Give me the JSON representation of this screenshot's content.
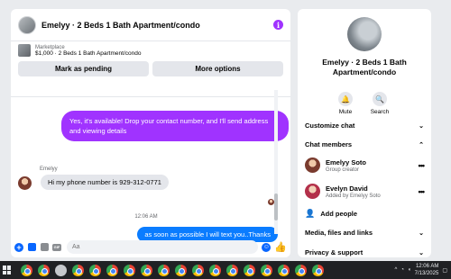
{
  "chat": {
    "title": "Emelyy · 2 Beds 1 Bath Apartment/condo",
    "info_icon": "info-icon",
    "marketplace": {
      "label": "Marketplace",
      "price_line": "$1,000 · 2 Beds 1 Bath Apartment/condo",
      "buttons": [
        "Mark as pending",
        "More options"
      ]
    },
    "messages": {
      "outgoing_1": "Yes, it's available! Drop your contact number, and I'll send address and viewing details",
      "incoming_name": "Emelyy",
      "incoming_1": "Hi my phone number is 929-312-0771",
      "timestamp": "12:06 AM",
      "outgoing_2": "as soon as possible I will text you..Thanks"
    },
    "composer": {
      "placeholder": "Aa"
    }
  },
  "info": {
    "title": "Emelyy · 2 Beds 1 Bath Apartment/condo",
    "actions": {
      "mute": "Mute",
      "search": "Search"
    },
    "sections": {
      "customize": "Customize chat",
      "members": "Chat members",
      "media": "Media, files and links",
      "privacy": "Privacy & support"
    },
    "members": [
      {
        "name": "Emelyy Soto",
        "sub": "Group creator"
      },
      {
        "name": "Evelyn David",
        "sub": "Added by Emelyy Soto"
      }
    ],
    "add_people": "Add people"
  },
  "taskbar": {
    "time": "12:06 AM",
    "date": "7/13/2025"
  },
  "colors": {
    "accent_purple": "#a033ff",
    "accent_blue": "#0a7cff",
    "panel_bg": "#ffffff",
    "page_bg": "#e9ebee",
    "taskbar_bg": "#202124"
  }
}
